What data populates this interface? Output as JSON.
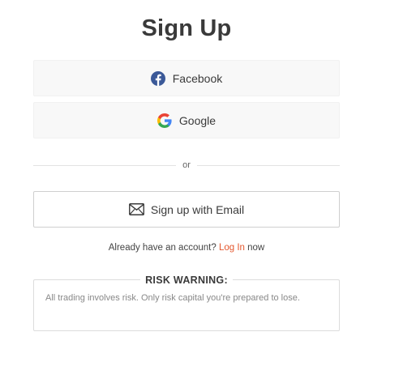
{
  "title": "Sign Up",
  "buttons": {
    "facebook_label": "Facebook",
    "google_label": "Google",
    "email_label": "Sign up with Email"
  },
  "divider": {
    "text": "or"
  },
  "login": {
    "prefix": "Already have an account?",
    "link_label": "Log In",
    "suffix": "now"
  },
  "risk_warning": {
    "heading": "RISK WARNING:",
    "text": "All trading involves risk. Only risk capital you're prepared to lose."
  },
  "colors": {
    "facebook_blue": "#3b5998",
    "link_orange": "#e4572e",
    "button_bg": "#f8f8f8",
    "text_dark": "#3a3a3a"
  },
  "icons": {
    "facebook": "facebook-icon",
    "google": "google-icon",
    "email": "envelope-icon"
  }
}
